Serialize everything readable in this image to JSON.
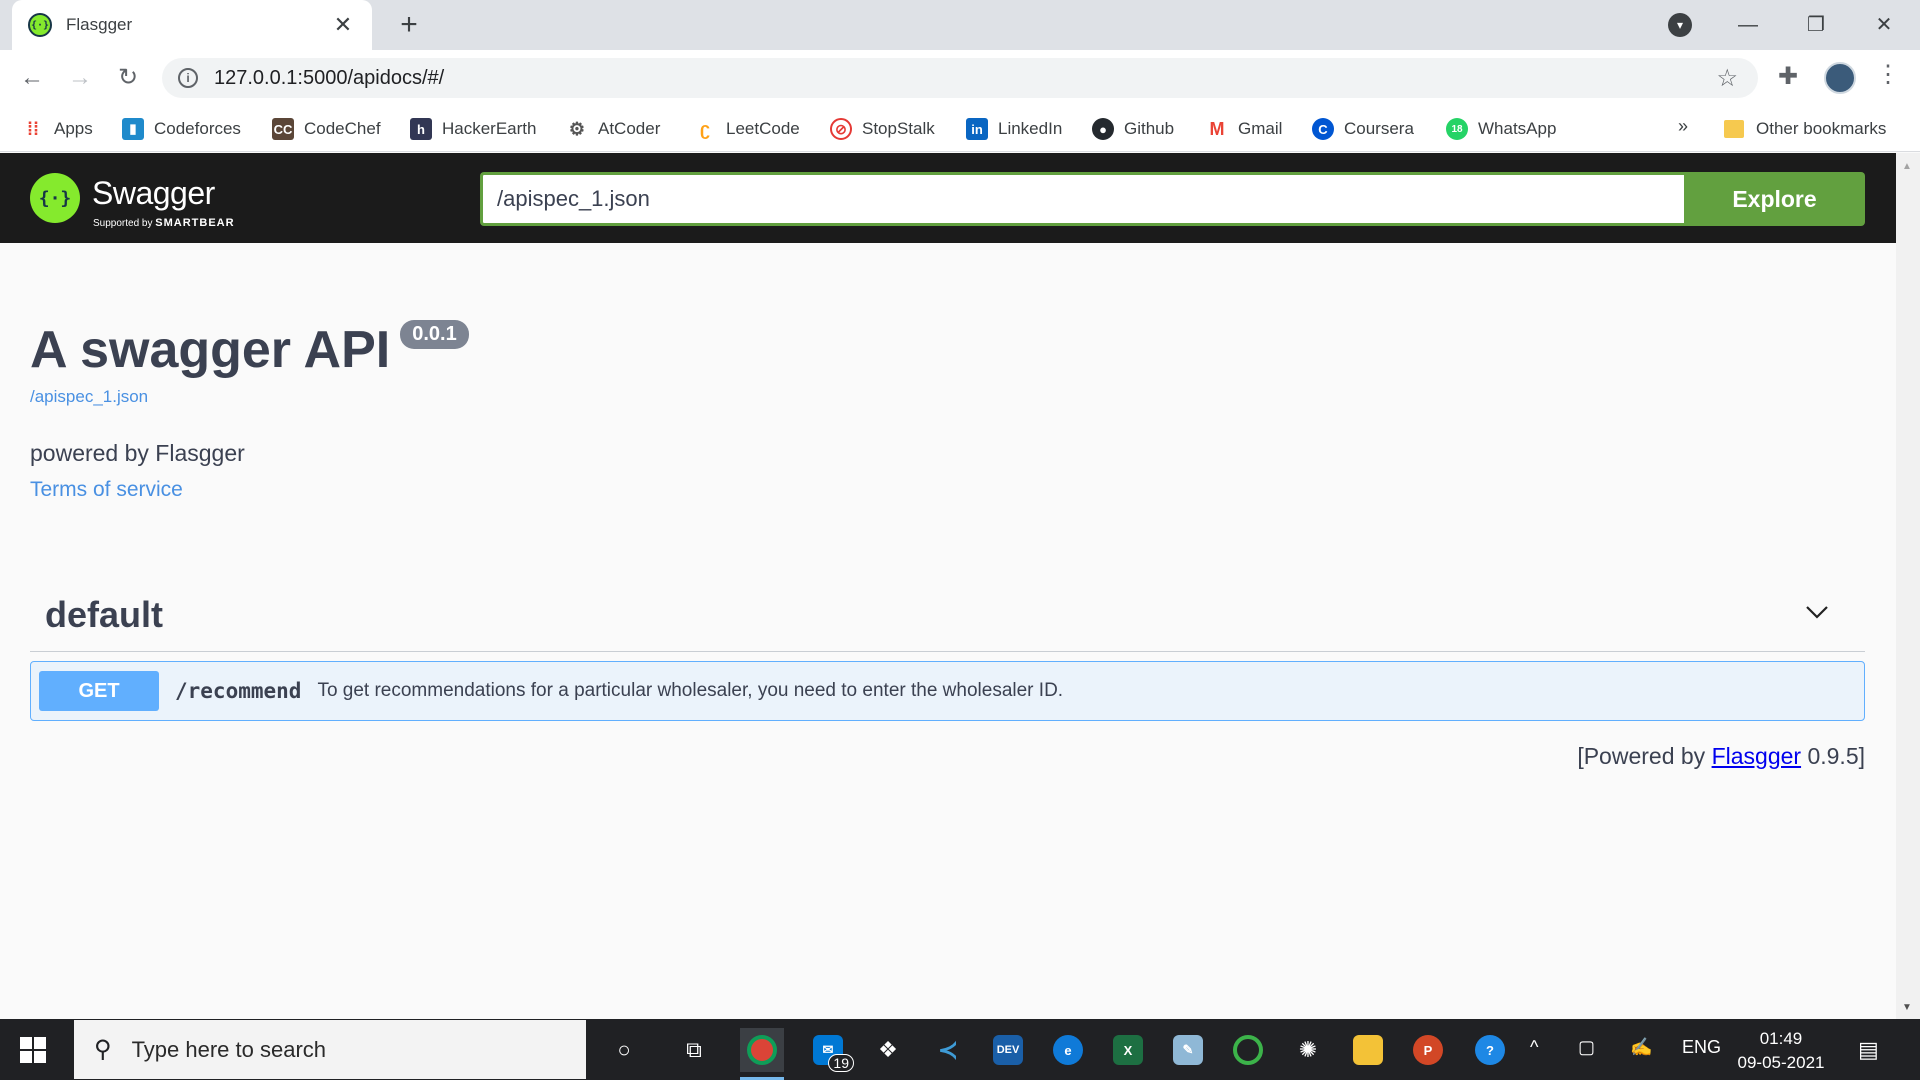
{
  "browser": {
    "tab_title": "Flasgger",
    "new_tab_symbol": "+",
    "url": "127.0.0.1:5000/apidocs/#/",
    "bookmarks": [
      {
        "label": "Apps",
        "icon": "apps-grid-icon",
        "color": "#ea4335"
      },
      {
        "label": "Codeforces",
        "icon": "codeforces-icon",
        "color": "#1f8acb"
      },
      {
        "label": "CodeChef",
        "icon": "codechef-icon",
        "color": "#5b4638"
      },
      {
        "label": "HackerEarth",
        "icon": "hackerearth-icon",
        "color": "#323754"
      },
      {
        "label": "AtCoder",
        "icon": "atcoder-icon",
        "color": "#555555"
      },
      {
        "label": "LeetCode",
        "icon": "leetcode-icon",
        "color": "#ffa116"
      },
      {
        "label": "StopStalk",
        "icon": "stopstalk-icon",
        "color": "#e53935"
      },
      {
        "label": "LinkedIn",
        "icon": "linkedin-icon",
        "color": "#0a66c2"
      },
      {
        "label": "Github",
        "icon": "github-icon",
        "color": "#24292e"
      },
      {
        "label": "Gmail",
        "icon": "gmail-icon",
        "color": "#ea4335"
      },
      {
        "label": "Coursera",
        "icon": "coursera-icon",
        "color": "#0056d2"
      },
      {
        "label": "WhatsApp",
        "icon": "whatsapp-icon",
        "color": "#25d366"
      }
    ],
    "more_bookmarks": "»",
    "other_bookmarks": "Other bookmarks"
  },
  "swagger": {
    "brand": "Swagger",
    "supported_by": "Supported by",
    "smartbear": "SMARTBEAR",
    "spec_url": "/apispec_1.json",
    "explore_label": "Explore",
    "accent": "#62a03f"
  },
  "info": {
    "title": "A swagger API",
    "version": "0.0.1",
    "spec_link": "/apispec_1.json",
    "description": "powered by Flasgger",
    "terms": "Terms of service"
  },
  "tag": {
    "name": "default"
  },
  "operation": {
    "method": "GET",
    "path": "/recommend",
    "summary": "To get recommendations for a particular wholesaler, you need to enter the wholesaler ID.",
    "method_color": "#61affe"
  },
  "footer": {
    "prefix": "[Powered by",
    "link": "Flasgger",
    "suffix": "0.9.5]"
  },
  "taskbar": {
    "search_placeholder": "Type here to search",
    "mail_badge": "19",
    "language": "ENG",
    "time": "01:49",
    "date": "09-05-2021"
  }
}
